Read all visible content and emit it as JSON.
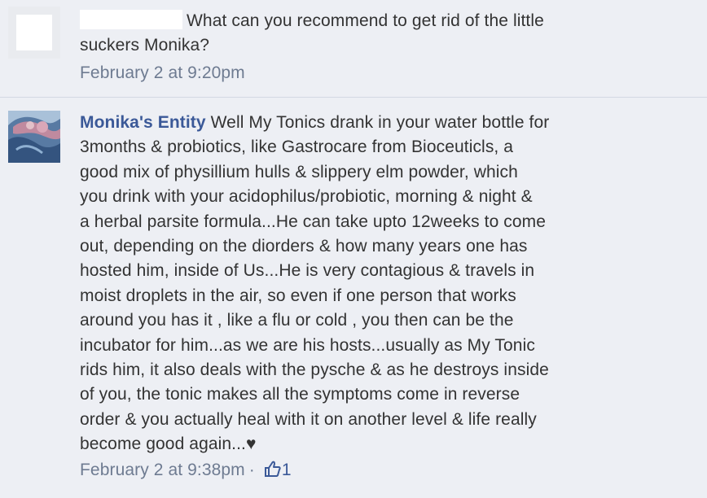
{
  "comments": [
    {
      "author": "",
      "text": "What can you recommend to get rid of the little\nsuckers Monika?",
      "timestamp": "February 2 at 9:20pm"
    },
    {
      "author": "Monika's Entity",
      "text": "Well My Tonics drank in your water bottle for\n3months & probiotics, like Gastrocare from Bioceuticls, a\ngood mix of physillium hulls & slippery elm powder, which\nyou drink with your acidophilus/probiotic, morning & night &\na herbal parsite formula...He can take upto 12weeks to come\nout, depending on the diorders & how many years one has\nhosted him, inside of Us...He is very contagious & travels in\nmoist droplets in the air, so even if one person that works\naround you has it , like a flu or cold , you then can be the\nincubator for him...as we are his hosts...usually as My Tonic\nrids him, it also deals with the pysche & as he destroys inside\nof you, the tonic makes all the symptoms come in reverse\norder & you actually heal with it on another level & life really\nbecome good again...♥",
      "timestamp": "February 2 at 9:38pm",
      "separator": "·",
      "like_icon": "thumbs-up-icon",
      "like_count": "1"
    }
  ],
  "colors": {
    "background": "#edeff4",
    "link": "#3b5998",
    "meta": "#6e7b91",
    "text": "#333333"
  }
}
